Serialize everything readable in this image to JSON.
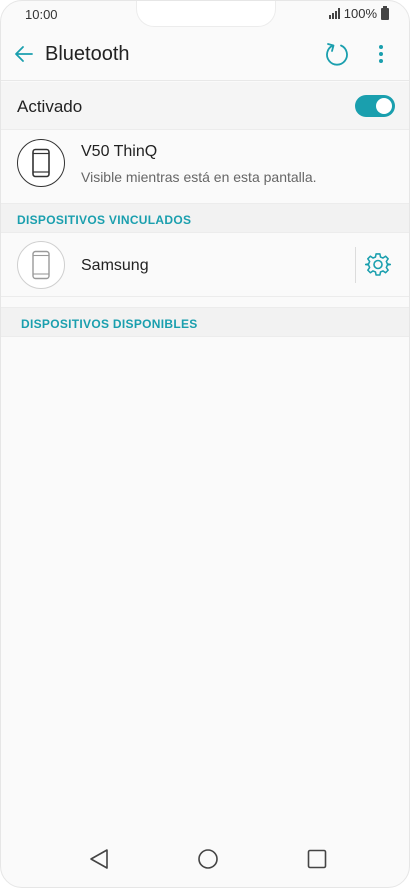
{
  "status_bar": {
    "time": "10:00",
    "battery": "100%"
  },
  "app_bar": {
    "title": "Bluetooth"
  },
  "bluetooth_toggle": {
    "label": "Activado",
    "state": "on"
  },
  "this_device": {
    "name": "V50 ThinQ",
    "subtitle": "Visible mientras está en esta pantalla."
  },
  "sections": {
    "paired": "DISPOSITIVOS VINCULADOS",
    "available": "DISPOSITIVOS DISPONIBLES"
  },
  "paired_devices": [
    {
      "name": "Samsung"
    }
  ],
  "colors": {
    "accent": "#1a9fae",
    "text": "#222222",
    "secondary_text": "#666666",
    "background": "#fafafa"
  },
  "icons": {
    "back": "arrow-left-icon",
    "refresh": "refresh-icon",
    "more": "more-vert-icon",
    "device": "phone-icon",
    "settings": "gear-icon",
    "nav_back": "triangle-back-icon",
    "nav_home": "circle-home-icon",
    "nav_recents": "square-recents-icon"
  }
}
